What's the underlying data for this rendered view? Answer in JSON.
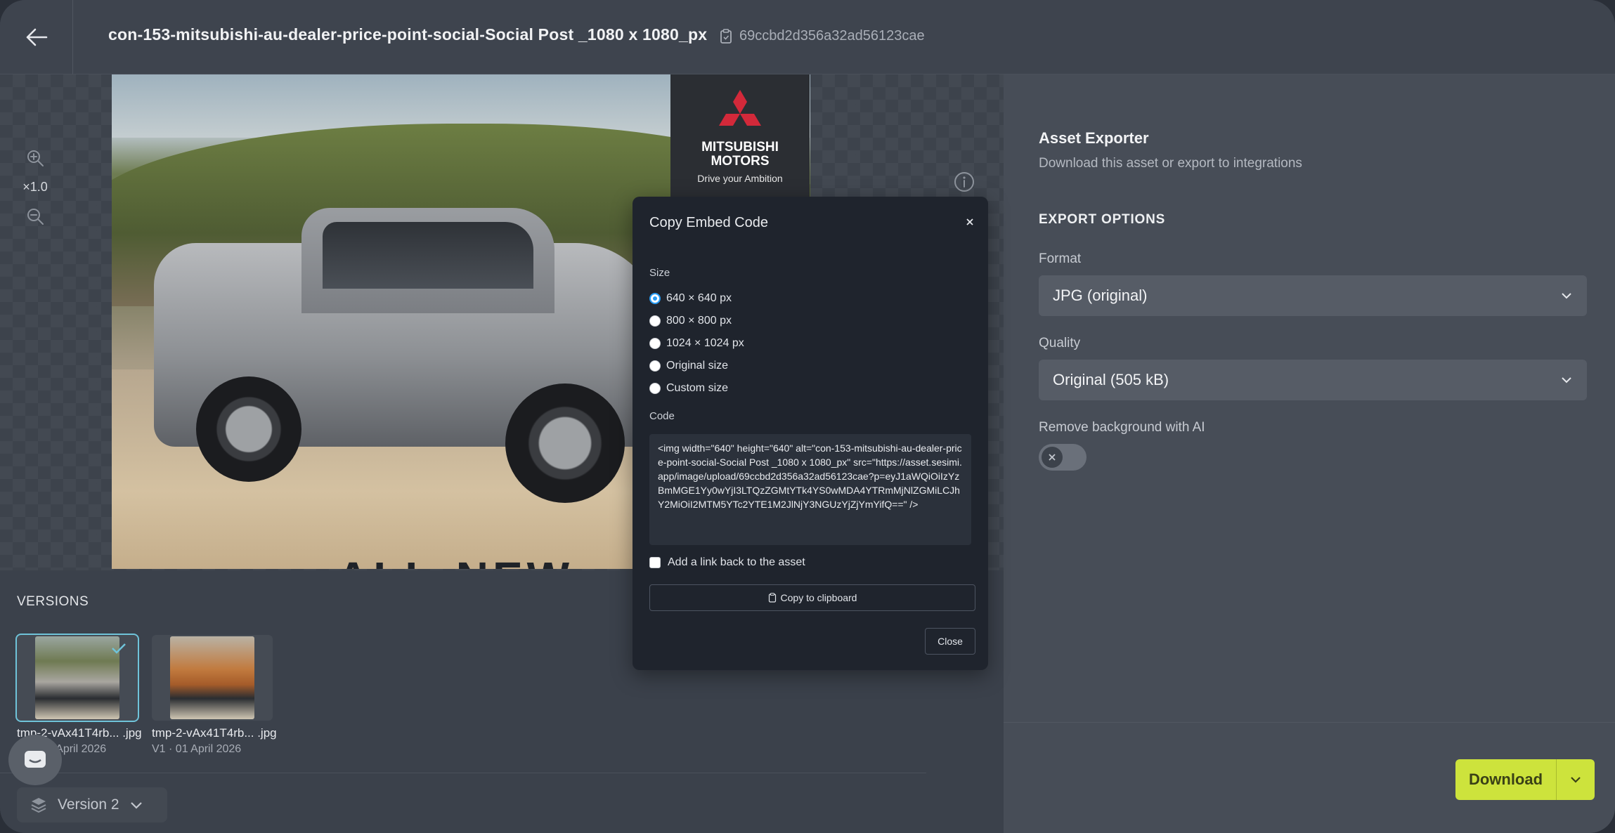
{
  "header": {
    "title": "con-153-mitsubishi-au-dealer-price-point-social-Social Post _1080 x 1080_px",
    "asset_id": "69ccbd2d356a32ad56123cae"
  },
  "canvas": {
    "zoom_level": "×1.0",
    "brand_name_line1": "MITSUBISHI",
    "brand_name_line2": "MOTORS",
    "brand_tagline": "Drive your Ambition",
    "hero_text": "ALL-NEW"
  },
  "versions": {
    "title": "VERSIONS",
    "items": [
      {
        "name": "tmp-2-vAx41T4rb... .jpg",
        "meta": "V2 · 01 April 2026",
        "selected": true,
        "color": "#b9a58a"
      },
      {
        "name": "tmp-2-vAx41T4rb... .jpg",
        "meta": "V1 · 01 April 2026",
        "selected": false,
        "color": "#c9a07a"
      }
    ],
    "current_version": "Version 2"
  },
  "exporter": {
    "title": "Asset Exporter",
    "subtitle": "Download this asset or export to integrations",
    "section_title": "EXPORT OPTIONS",
    "format_label": "Format",
    "format_value": "JPG (original)",
    "quality_label": "Quality",
    "quality_value": "Original (505 kB)",
    "remove_bg_label": "Remove background with AI",
    "remove_bg_enabled": false,
    "download_label": "Download"
  },
  "modal": {
    "title": "Copy Embed Code",
    "size_label": "Size",
    "size_options": [
      "640 × 640 px",
      "800 × 800 px",
      "1024 × 1024 px",
      "Original size",
      "Custom size"
    ],
    "selected_size": "640 × 640 px",
    "code_label": "Code",
    "code": "<img width=\"640\" height=\"640\" alt=\"con-153-mitsubishi-au-dealer-price-point-social-Social Post _1080 x 1080_px\" src=\"https://asset.sesimi.app/image/upload/69ccbd2d356a32ad56123cae?p=eyJ1aWQiOiIzYzBmMGE1Yy0wYjI3LTQzZGMtYTk4YS0wMDA4YTRmMjNlZGMiLCJhY2MiOiI2MTM5YTc2YTE1M2JlNjY3NGUzYjZjYmYifQ==\" />",
    "link_back_label": "Add a link back to the asset",
    "link_back_checked": false,
    "copy_label": "Copy to clipboard",
    "close_label": "Close"
  },
  "colors": {
    "accent_download": "#cde33c",
    "radio_selected": "#2a9df4",
    "selected_outline": "#6fc3d9",
    "brand_red": "#d3293a"
  }
}
